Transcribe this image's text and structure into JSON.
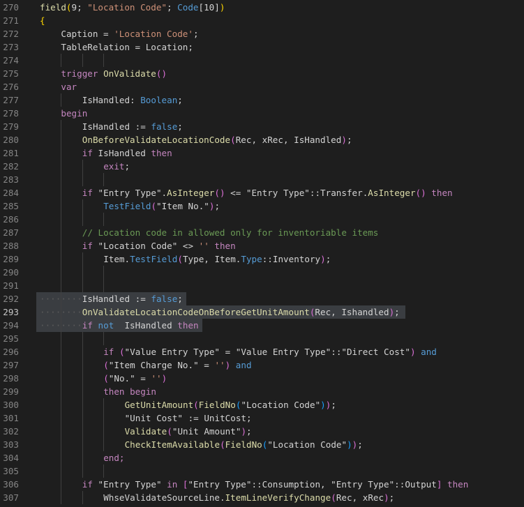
{
  "editor": {
    "lines": [
      {
        "num": "270",
        "tokens": [
          [
            "field",
            "c-func"
          ],
          [
            "(",
            "c-brace"
          ],
          [
            "9; ",
            "c-default"
          ],
          [
            "\"Location Code\"",
            "c-str"
          ],
          [
            "; ",
            "c-default"
          ],
          [
            "Code",
            "c-type"
          ],
          [
            "[10]",
            "c-default"
          ],
          [
            ")",
            "c-brace"
          ]
        ]
      },
      {
        "num": "271",
        "tokens": [
          [
            "{",
            "c-brace"
          ]
        ]
      },
      {
        "num": "272",
        "tokens": [
          [
            "Caption = ",
            "c-default"
          ],
          [
            "'Location Code'",
            "c-str"
          ],
          [
            ";",
            "c-default"
          ]
        ]
      },
      {
        "num": "273",
        "tokens": [
          [
            "TableRelation = Location;",
            "c-default"
          ]
        ]
      },
      {
        "num": "274",
        "tokens": []
      },
      {
        "num": "275",
        "tokens": [
          [
            "trigger ",
            "c-kw"
          ],
          [
            "OnValidate",
            "c-func"
          ],
          [
            "()",
            "c-paren"
          ]
        ]
      },
      {
        "num": "276",
        "tokens": [
          [
            "var",
            "c-kw"
          ]
        ]
      },
      {
        "num": "277",
        "tokens": [
          [
            "IsHandled: ",
            "c-default"
          ],
          [
            "Boolean",
            "c-type"
          ],
          [
            ";",
            "c-default"
          ]
        ]
      },
      {
        "num": "278",
        "tokens": [
          [
            "begin",
            "c-kw"
          ]
        ]
      },
      {
        "num": "279",
        "tokens": [
          [
            "IsHandled := ",
            "c-default"
          ],
          [
            "false",
            "c-bool"
          ],
          [
            ";",
            "c-default"
          ]
        ]
      },
      {
        "num": "280",
        "tokens": [
          [
            "OnBeforeValidateLocationCode",
            "c-func"
          ],
          [
            "(",
            "c-paren"
          ],
          [
            "Rec, xRec, IsHandled",
            "c-default"
          ],
          [
            ")",
            "c-paren"
          ],
          [
            ";",
            "c-default"
          ]
        ]
      },
      {
        "num": "281",
        "tokens": [
          [
            "if ",
            "c-kw"
          ],
          [
            "IsHandled ",
            "c-default"
          ],
          [
            "then",
            "c-kw"
          ]
        ]
      },
      {
        "num": "282",
        "tokens": [
          [
            "exit",
            "c-kw"
          ],
          [
            ";",
            "c-default"
          ]
        ]
      },
      {
        "num": "283",
        "tokens": []
      },
      {
        "num": "284",
        "tokens": [
          [
            "if ",
            "c-kw"
          ],
          [
            "\"Entry Type\".",
            "c-default"
          ],
          [
            "AsInteger",
            "c-func"
          ],
          [
            "()",
            "c-paren"
          ],
          [
            " <= ",
            "c-default"
          ],
          [
            "\"Entry Type\"::Transfer.",
            "c-default"
          ],
          [
            "AsInteger",
            "c-func"
          ],
          [
            "()",
            "c-paren"
          ],
          [
            " then",
            "c-kw"
          ]
        ]
      },
      {
        "num": "285",
        "tokens": [
          [
            "TestField",
            "c-type"
          ],
          [
            "(",
            "c-paren"
          ],
          [
            "\"Item No.\"",
            "c-default"
          ],
          [
            ")",
            "c-paren"
          ],
          [
            ";",
            "c-default"
          ]
        ]
      },
      {
        "num": "286",
        "tokens": []
      },
      {
        "num": "287",
        "tokens": [
          [
            "// Location code in allowed only for inventoriable items",
            "c-comment"
          ]
        ]
      },
      {
        "num": "288",
        "tokens": [
          [
            "if ",
            "c-kw"
          ],
          [
            "\"Location Code\" <> ",
            "c-default"
          ],
          [
            "''",
            "c-str"
          ],
          [
            " then",
            "c-kw"
          ]
        ]
      },
      {
        "num": "289",
        "tokens": [
          [
            "Item.",
            "c-default"
          ],
          [
            "TestField",
            "c-type"
          ],
          [
            "(",
            "c-paren"
          ],
          [
            "Type, Item.",
            "c-default"
          ],
          [
            "Type",
            "c-type"
          ],
          [
            "::Inventory",
            "c-default"
          ],
          [
            ")",
            "c-paren"
          ],
          [
            ";",
            "c-default"
          ]
        ]
      },
      {
        "num": "290",
        "tokens": []
      },
      {
        "num": "291",
        "tokens": []
      },
      {
        "num": "292",
        "tokens": [
          [
            "IsHandled := ",
            "c-default"
          ],
          [
            "false",
            "c-bool"
          ],
          [
            ";",
            "c-default"
          ]
        ]
      },
      {
        "num": "293",
        "tokens": [
          [
            "OnValidateLocationCodeOnBeforeGetUnitAmount",
            "c-func"
          ],
          [
            "(",
            "c-paren"
          ],
          [
            "Rec, Ishandled",
            "c-default"
          ],
          [
            ")",
            "c-paren"
          ],
          [
            ";",
            "c-default"
          ]
        ]
      },
      {
        "num": "294",
        "tokens": [
          [
            "if ",
            "c-kw"
          ],
          [
            "not ",
            "c-type"
          ],
          [
            " IsHandled ",
            "c-default"
          ],
          [
            "then",
            "c-kw"
          ]
        ]
      },
      {
        "num": "295",
        "tokens": []
      },
      {
        "num": "296",
        "tokens": [
          [
            "if ",
            "c-kw"
          ],
          [
            "(",
            "c-paren"
          ],
          [
            "\"Value Entry Type\" = \"Value Entry Type\"::\"Direct Cost\"",
            "c-default"
          ],
          [
            ")",
            "c-paren"
          ],
          [
            " and",
            "c-type"
          ]
        ]
      },
      {
        "num": "297",
        "tokens": [
          [
            "(",
            "c-paren"
          ],
          [
            "\"Item Charge No.\" = ",
            "c-default"
          ],
          [
            "''",
            "c-str"
          ],
          [
            ")",
            "c-paren"
          ],
          [
            " and",
            "c-type"
          ]
        ]
      },
      {
        "num": "298",
        "tokens": [
          [
            "(",
            "c-paren"
          ],
          [
            "\"No.\" = ",
            "c-default"
          ],
          [
            "''",
            "c-str"
          ],
          [
            ")",
            "c-paren"
          ]
        ]
      },
      {
        "num": "299",
        "tokens": [
          [
            "then begin",
            "c-kw"
          ]
        ]
      },
      {
        "num": "300",
        "tokens": [
          [
            "GetUnitAmount",
            "c-func"
          ],
          [
            "(",
            "c-paren"
          ],
          [
            "FieldNo",
            "c-func"
          ],
          [
            "(",
            "c-paren2"
          ],
          [
            "\"Location Code\"",
            "c-default"
          ],
          [
            ")",
            "c-paren2"
          ],
          [
            ")",
            "c-paren"
          ],
          [
            ";",
            "c-default"
          ]
        ]
      },
      {
        "num": "301",
        "tokens": [
          [
            "\"Unit Cost\" := UnitCost;",
            "c-default"
          ]
        ]
      },
      {
        "num": "302",
        "tokens": [
          [
            "Validate",
            "c-func"
          ],
          [
            "(",
            "c-paren"
          ],
          [
            "\"Unit Amount\"",
            "c-default"
          ],
          [
            ")",
            "c-paren"
          ],
          [
            ";",
            "c-default"
          ]
        ]
      },
      {
        "num": "303",
        "tokens": [
          [
            "CheckItemAvailable",
            "c-func"
          ],
          [
            "(",
            "c-paren"
          ],
          [
            "FieldNo",
            "c-func"
          ],
          [
            "(",
            "c-paren2"
          ],
          [
            "\"Location Code\"",
            "c-default"
          ],
          [
            ")",
            "c-paren2"
          ],
          [
            ")",
            "c-paren"
          ],
          [
            ";",
            "c-default"
          ]
        ]
      },
      {
        "num": "304",
        "tokens": [
          [
            "end;",
            "c-kw"
          ]
        ]
      },
      {
        "num": "305",
        "tokens": []
      },
      {
        "num": "306",
        "tokens": [
          [
            "if ",
            "c-kw"
          ],
          [
            "\"Entry Type\" ",
            "c-default"
          ],
          [
            "in ",
            "c-kw"
          ],
          [
            "[",
            "c-paren"
          ],
          [
            "\"Entry Type\"::Consumption, \"Entry Type\"::Output",
            "c-default"
          ],
          [
            "]",
            "c-paren"
          ],
          [
            " then",
            "c-kw"
          ]
        ]
      },
      {
        "num": "307",
        "tokens": [
          [
            "WhseValidateSourceLine.",
            "c-default"
          ],
          [
            "ItemLineVerifyChange",
            "c-func"
          ],
          [
            "(",
            "c-paren"
          ],
          [
            "Rec, xRec",
            "c-default"
          ],
          [
            ")",
            "c-paren"
          ],
          [
            ";",
            "c-default"
          ]
        ]
      }
    ]
  }
}
